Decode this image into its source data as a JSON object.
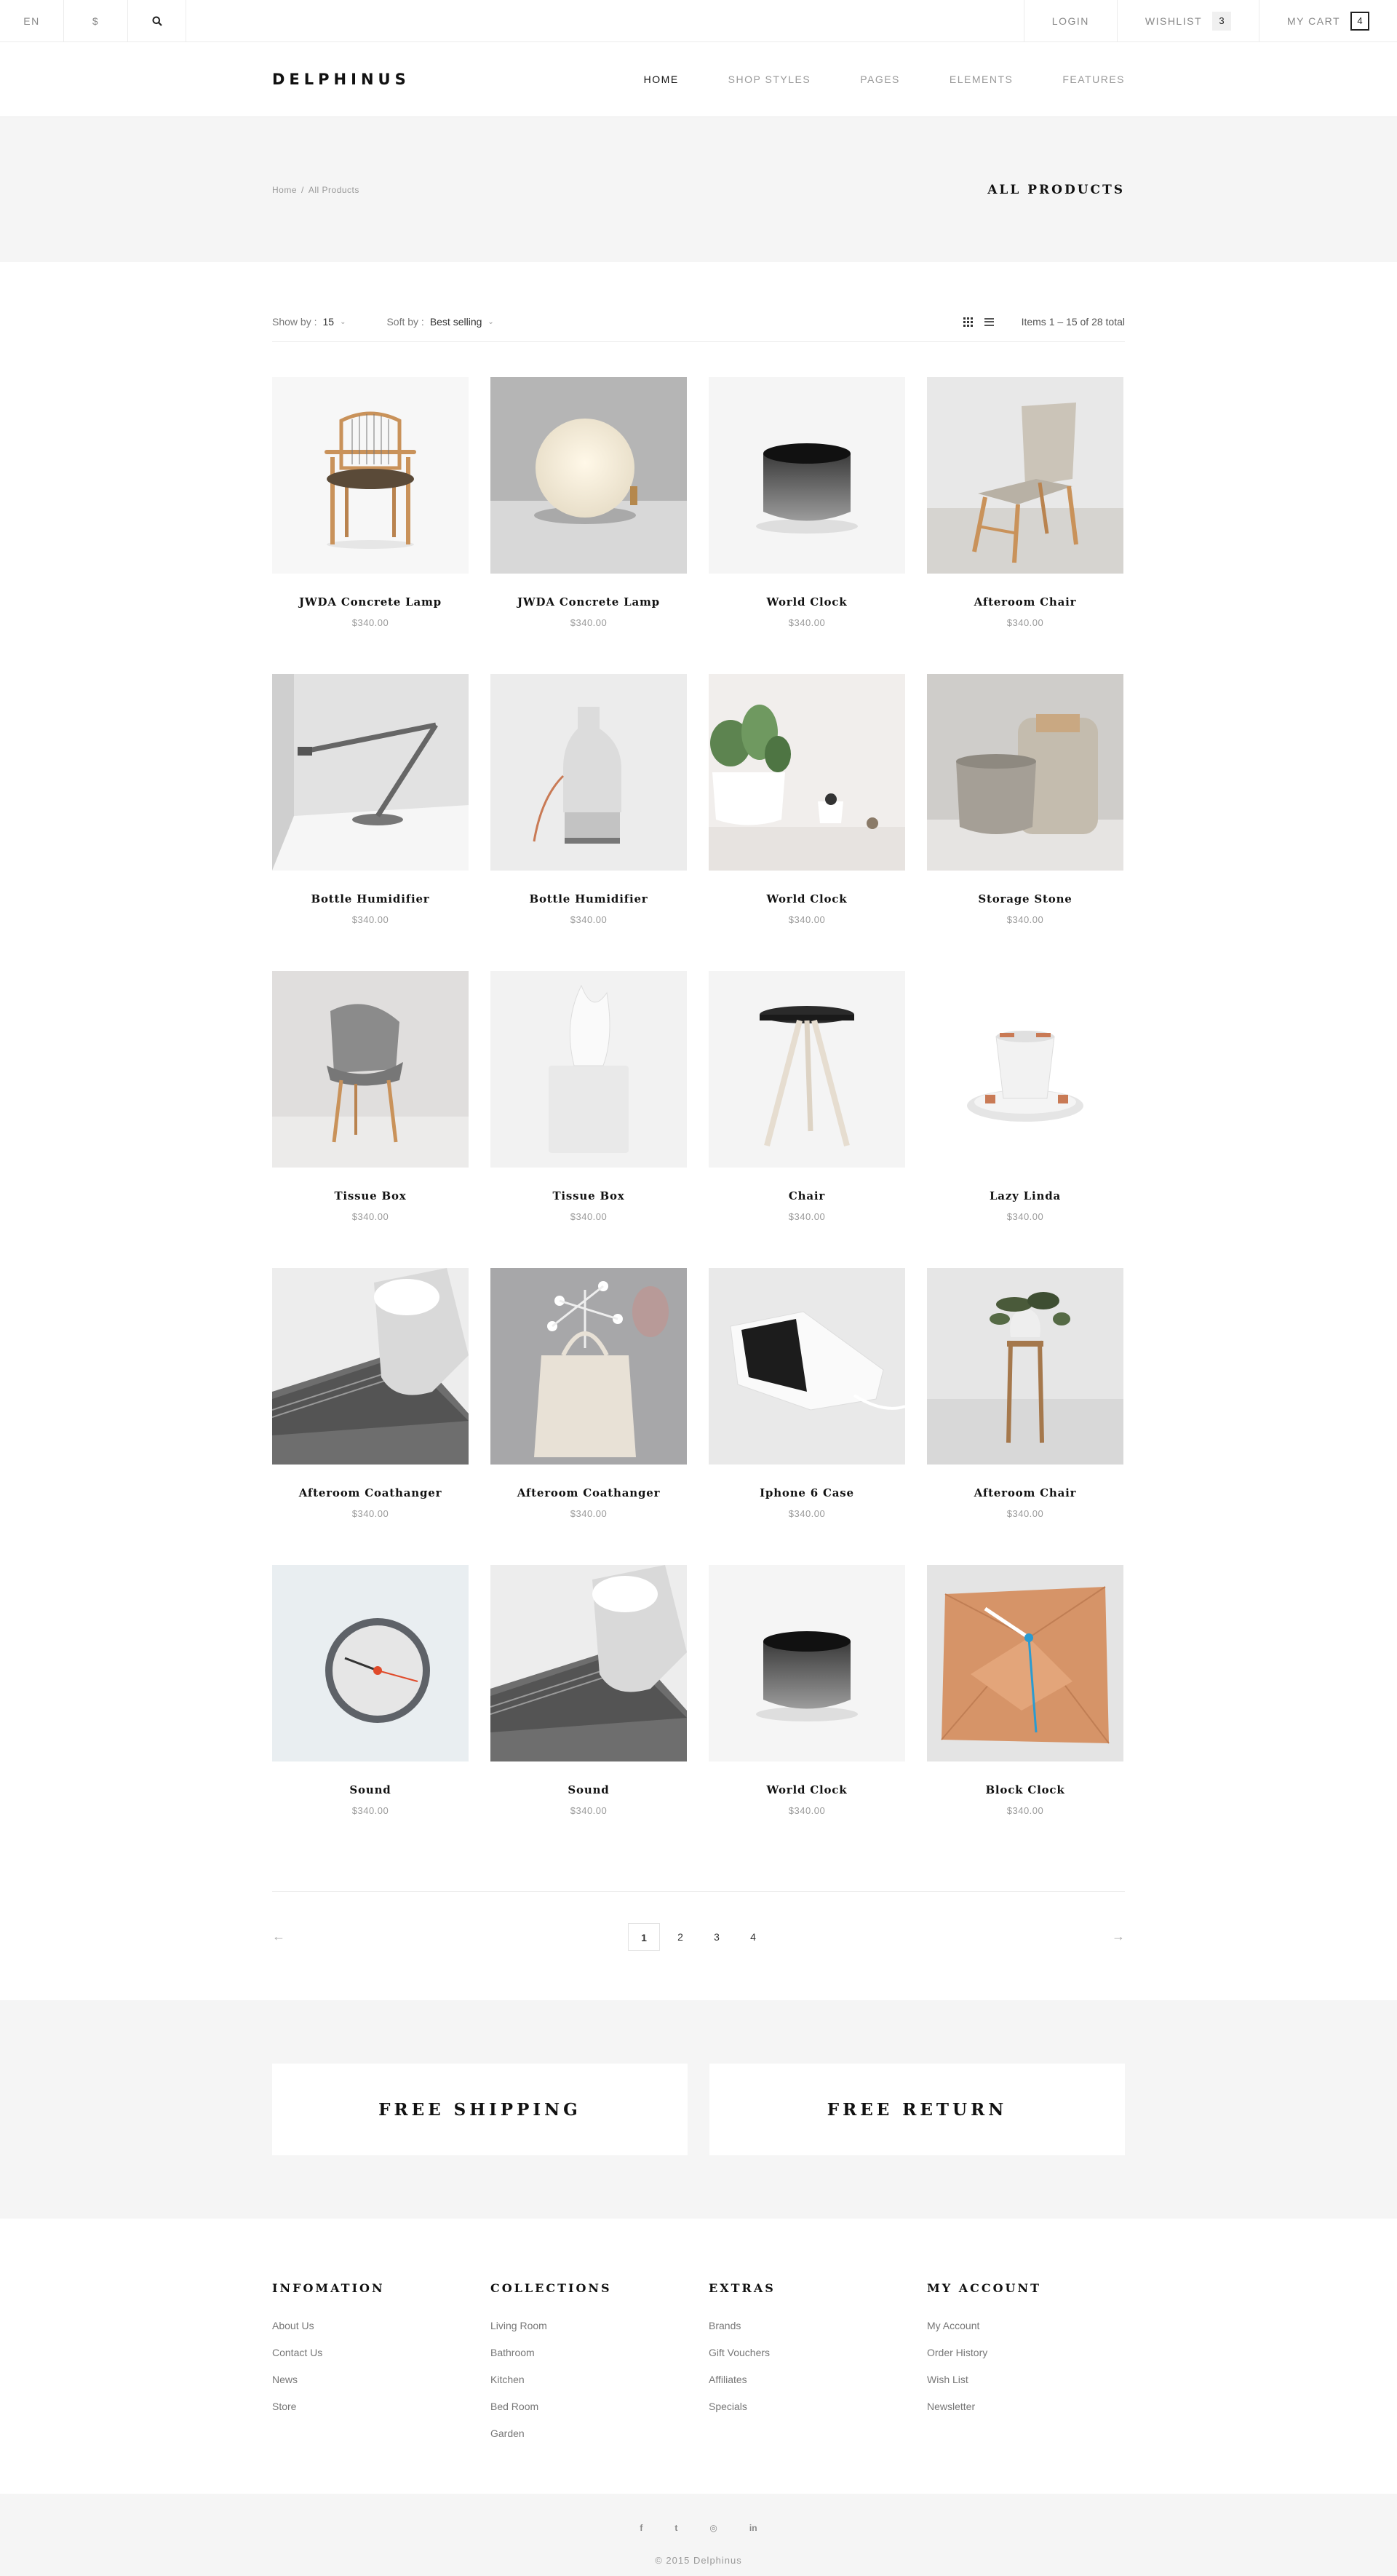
{
  "topbar": {
    "language": "EN",
    "currency": "$",
    "search_icon": "search-icon",
    "login_label": "LOGIN",
    "wishlist_label": "WISHLIST",
    "wishlist_count": "3",
    "cart_label": "MY CART",
    "cart_count": "4"
  },
  "header": {
    "logo": "DELPHINUS",
    "nav": [
      "HOME",
      "SHOP STYLES",
      "PAGES",
      "ELEMENTS",
      "FEATURES"
    ]
  },
  "titleband": {
    "breadcrumb": [
      "Home",
      "/",
      "All Products"
    ],
    "title": "ALL PRODUCTS"
  },
  "toolbar": {
    "show_label": "Show by :",
    "show_value": "15",
    "sort_label": "Soft by :",
    "sort_value": "Best selling",
    "items_count": "Items 1 – 15 of 28 total"
  },
  "products": [
    {
      "name": "JWDA Concrete Lamp",
      "price": "$340.00"
    },
    {
      "name": "JWDA Concrete Lamp",
      "price": "$340.00"
    },
    {
      "name": "World Clock",
      "price": "$340.00"
    },
    {
      "name": "Afteroom Chair",
      "price": "$340.00"
    },
    {
      "name": "Bottle Humidifier",
      "price": "$340.00"
    },
    {
      "name": "Bottle Humidifier",
      "price": "$340.00"
    },
    {
      "name": "World Clock",
      "price": "$340.00"
    },
    {
      "name": "Storage Stone",
      "price": "$340.00"
    },
    {
      "name": "Tissue Box",
      "price": "$340.00"
    },
    {
      "name": "Tissue Box",
      "price": "$340.00"
    },
    {
      "name": "Chair",
      "price": "$340.00"
    },
    {
      "name": "Lazy Linda",
      "price": "$340.00"
    },
    {
      "name": "Afteroom Coathanger",
      "price": "$340.00"
    },
    {
      "name": "Afteroom Coathanger",
      "price": "$340.00"
    },
    {
      "name": "Iphone 6 Case",
      "price": "$340.00"
    },
    {
      "name": "Afteroom Chair",
      "price": "$340.00"
    },
    {
      "name": "Sound",
      "price": "$340.00"
    },
    {
      "name": "Sound",
      "price": "$340.00"
    },
    {
      "name": "World Clock",
      "price": "$340.00"
    },
    {
      "name": "Block Clock",
      "price": "$340.00"
    }
  ],
  "pagination": {
    "prev_arrow": "←",
    "next_arrow": "→",
    "pages": [
      "1",
      "2",
      "3",
      "4"
    ],
    "current": "1"
  },
  "features": [
    "FREE SHIPPING",
    "FREE RETURN"
  ],
  "footer": {
    "columns": [
      {
        "title": "INFOMATION",
        "links": [
          "About Us",
          "Contact Us",
          "News",
          "Store"
        ]
      },
      {
        "title": "COLLECTIONS",
        "links": [
          "Living Room",
          "Bathroom",
          "Kitchen",
          "Bed Room",
          "Garden"
        ]
      },
      {
        "title": "EXTRAS",
        "links": [
          "Brands",
          "Gift Vouchers",
          "Affiliates",
          "Specials"
        ]
      },
      {
        "title": "MY ACCOUNT",
        "links": [
          "My Account",
          "Order History",
          "Wish List",
          "Newsletter"
        ]
      }
    ],
    "socials": [
      {
        "icon": "facebook-icon",
        "glyph": "f"
      },
      {
        "icon": "twitter-icon",
        "glyph": "t"
      },
      {
        "icon": "instagram-icon",
        "glyph": "◎"
      },
      {
        "icon": "linkedin-icon",
        "glyph": "in"
      }
    ],
    "copyright": "© 2015 Delphinus"
  }
}
